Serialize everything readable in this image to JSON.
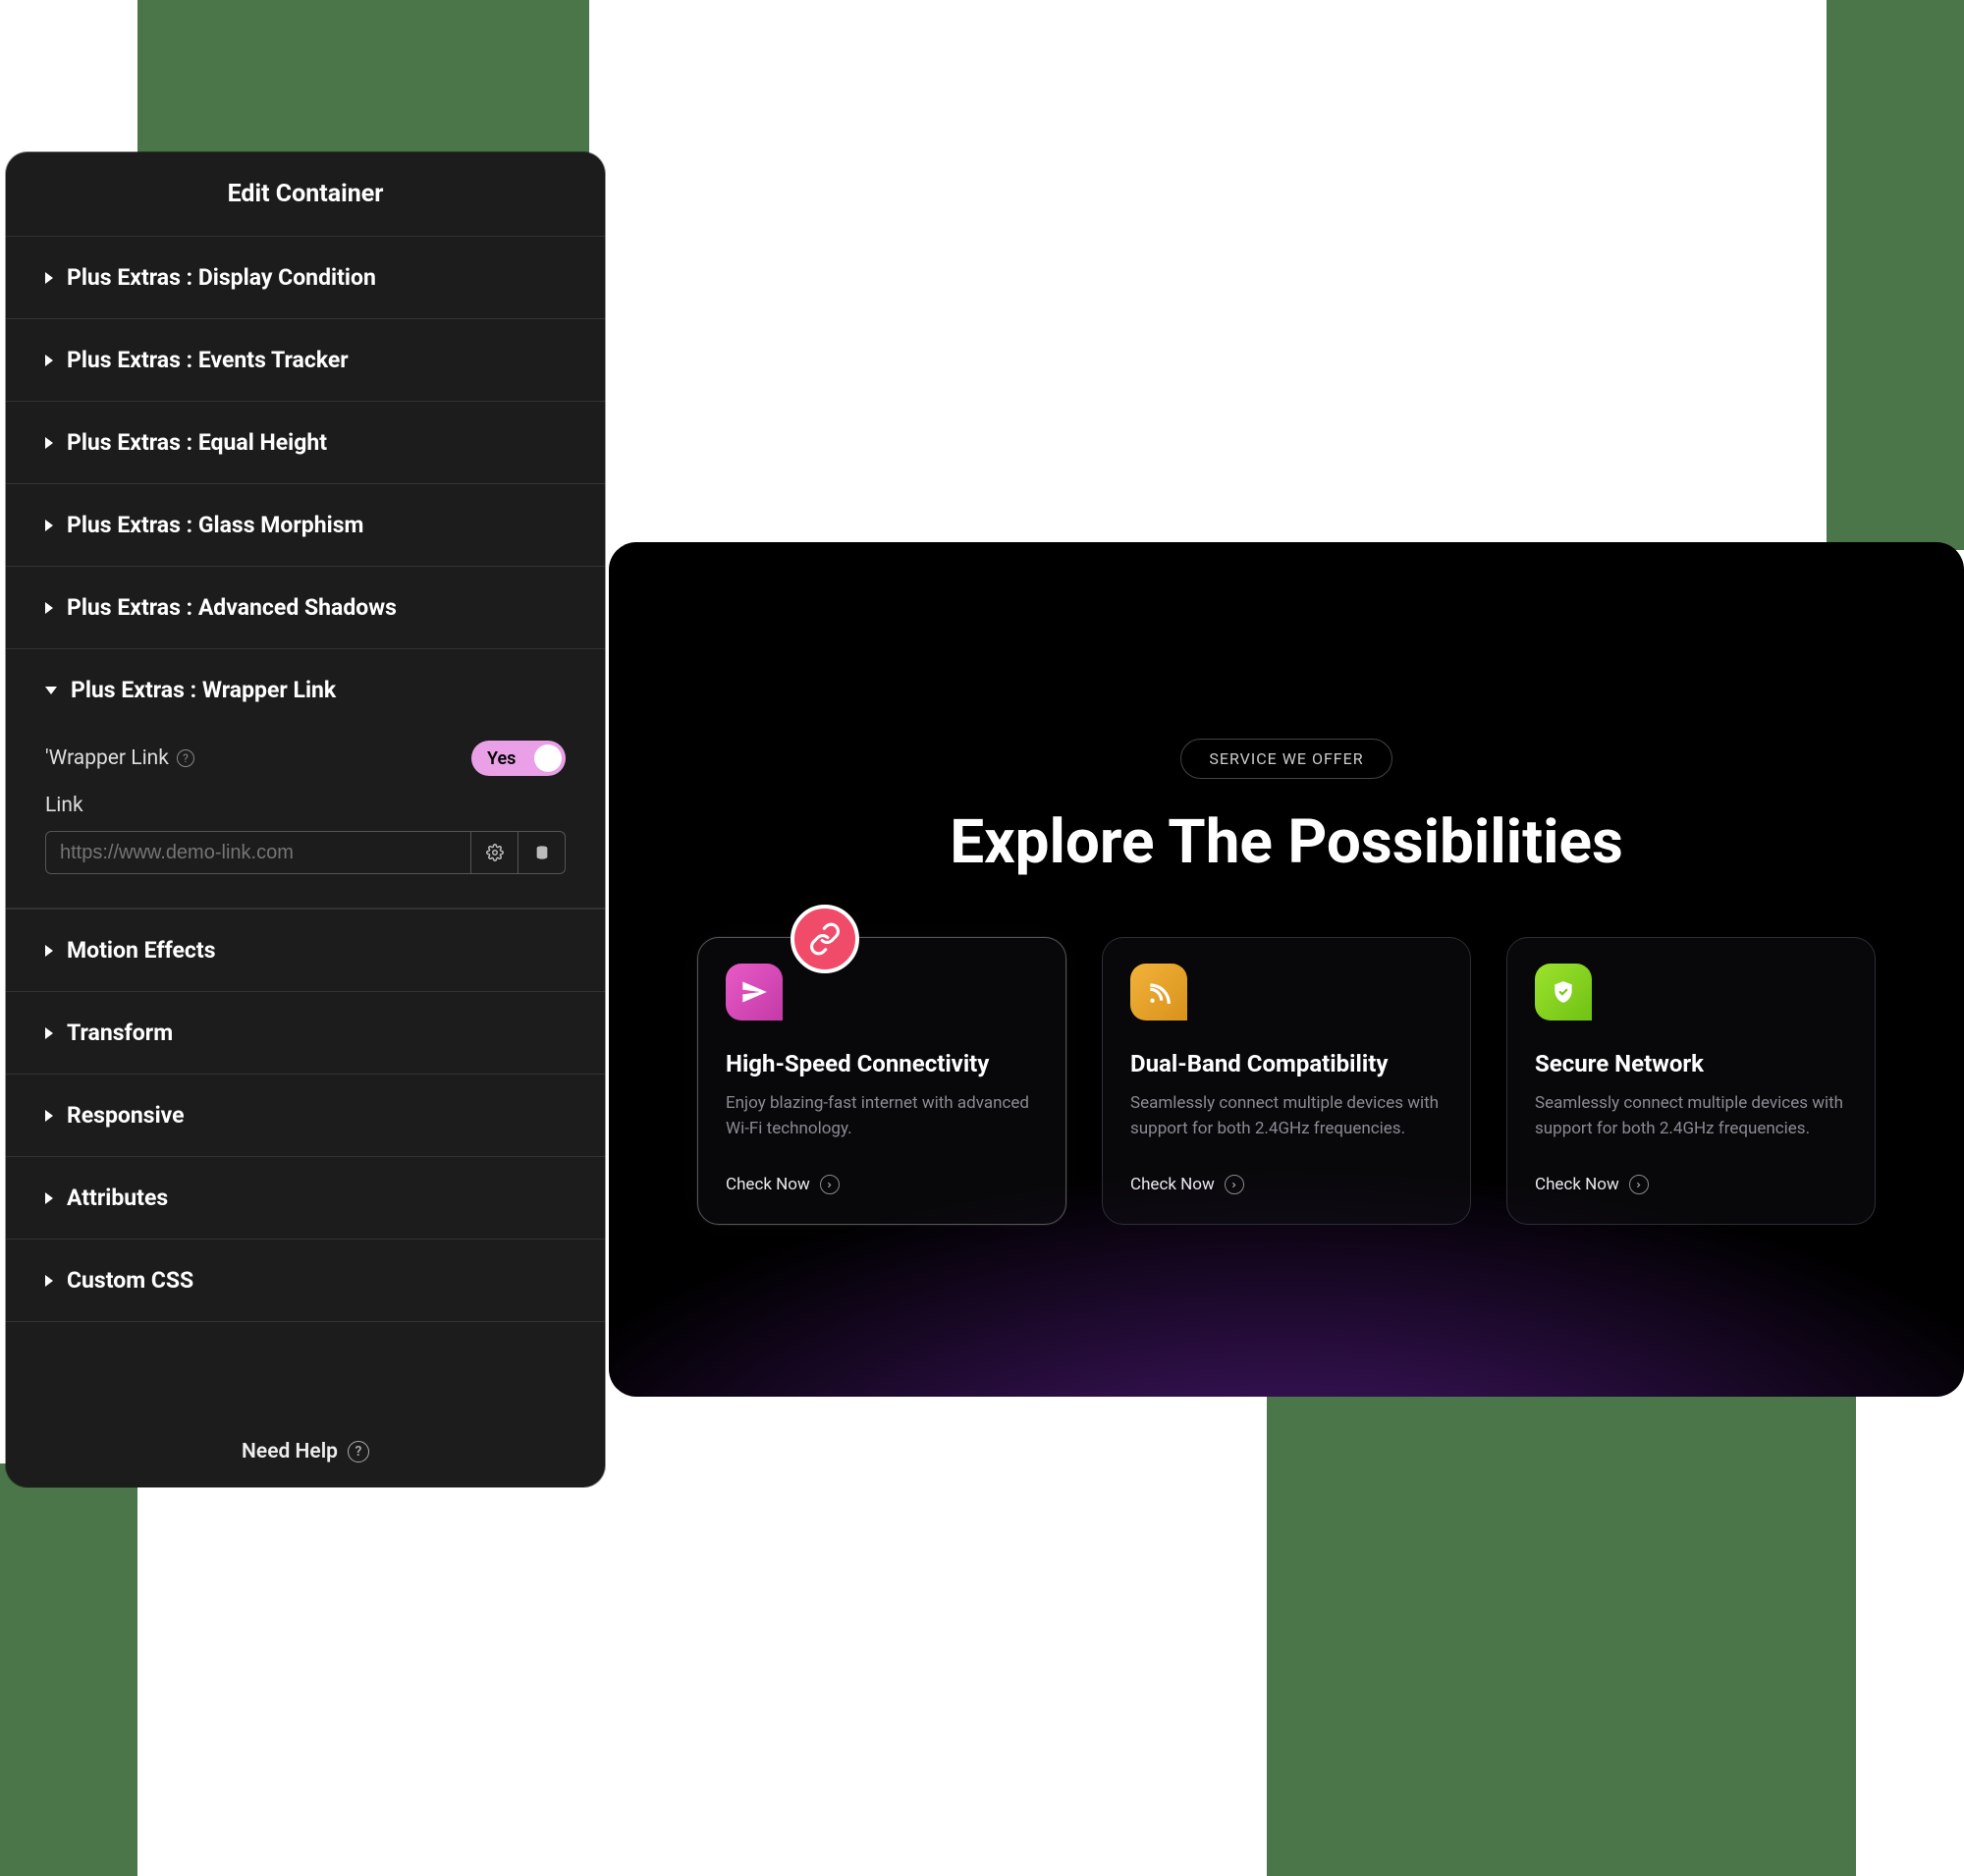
{
  "panel": {
    "title": "Edit Container",
    "sections_top": [
      {
        "label": "Plus Extras : Display Condition"
      },
      {
        "label": "Plus Extras : Events Tracker"
      },
      {
        "label": "Plus Extras : Equal Height"
      },
      {
        "label": "Plus Extras : Glass Morphism"
      },
      {
        "label": "Plus Extras : Advanced Shadows"
      }
    ],
    "wrapper_link_section": {
      "label": "Plus Extras : Wrapper Link",
      "toggle_row_label": "'Wrapper Link",
      "toggle_value": "Yes",
      "link_label": "Link",
      "link_placeholder": "https://www.demo-link.com"
    },
    "sections_bottom": [
      {
        "label": "Motion Effects"
      },
      {
        "label": "Transform"
      },
      {
        "label": "Responsive"
      },
      {
        "label": "Attributes"
      },
      {
        "label": "Custom CSS"
      }
    ],
    "help_label": "Need Help"
  },
  "preview": {
    "pill": "SERVICE WE OFFER",
    "hero": "Explore The Possibilities",
    "cards": [
      {
        "icon": "paper-plane",
        "title": "High-Speed Connectivity",
        "desc": "Enjoy blazing-fast internet with advanced Wi-Fi technology.",
        "cta": "Check Now"
      },
      {
        "icon": "rss",
        "title": "Dual-Band Compatibility",
        "desc": "Seamlessly connect multiple devices with support for both 2.4GHz frequencies.",
        "cta": "Check Now"
      },
      {
        "icon": "shield",
        "title": "Secure Network",
        "desc": "Seamlessly connect multiple devices with support for both 2.4GHz frequencies.",
        "cta": "Check Now"
      }
    ]
  }
}
